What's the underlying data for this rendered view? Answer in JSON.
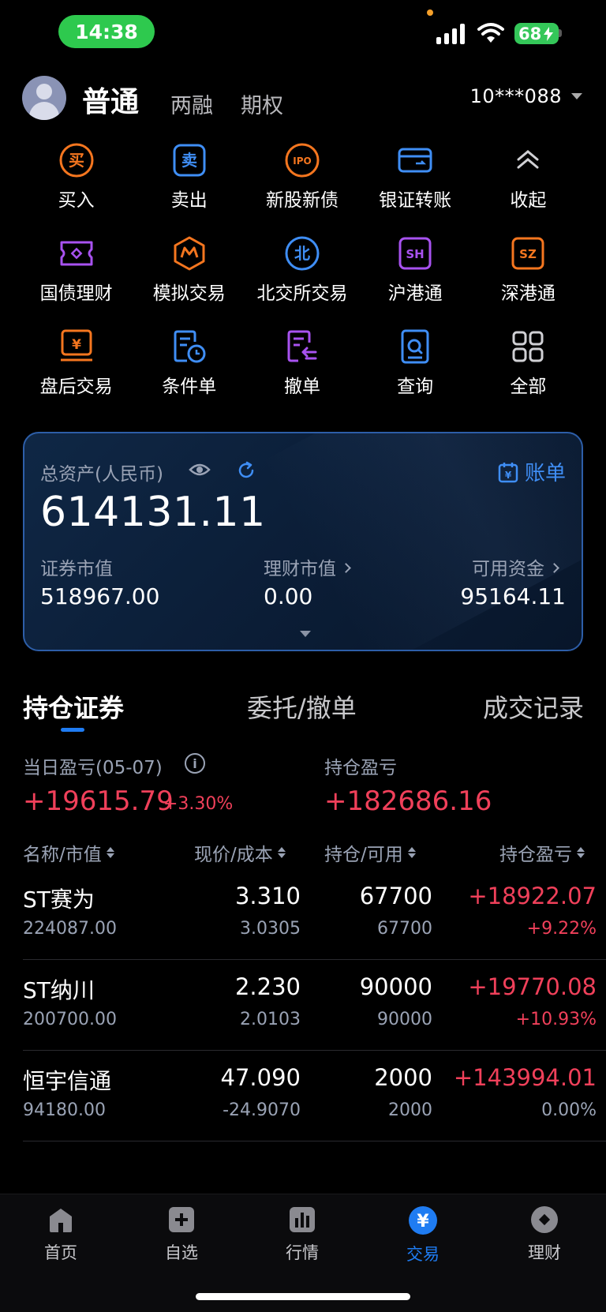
{
  "status_bar": {
    "time": "14:38",
    "battery": "68"
  },
  "account": {
    "tabs": [
      "普通",
      "两融",
      "期权"
    ],
    "account_no": "10***088"
  },
  "quick_actions": [
    {
      "label": "买入",
      "icon": "buy-icon"
    },
    {
      "label": "卖出",
      "icon": "sell-icon"
    },
    {
      "label": "新股新债",
      "icon": "ipo-icon"
    },
    {
      "label": "银证转账",
      "icon": "bank-transfer-icon"
    },
    {
      "label": "收起",
      "icon": "collapse-icon"
    },
    {
      "label": "国债理财",
      "icon": "treasury-icon"
    },
    {
      "label": "模拟交易",
      "icon": "simulate-icon"
    },
    {
      "label": "北交所交易",
      "icon": "bse-icon"
    },
    {
      "label": "沪港通",
      "icon": "sh-connect-icon"
    },
    {
      "label": "深港通",
      "icon": "sz-connect-icon"
    },
    {
      "label": "盘后交易",
      "icon": "after-hours-icon"
    },
    {
      "label": "条件单",
      "icon": "conditional-order-icon"
    },
    {
      "label": "撤单",
      "icon": "cancel-order-icon"
    },
    {
      "label": "查询",
      "icon": "query-icon"
    },
    {
      "label": "全部",
      "icon": "all-icon"
    }
  ],
  "assets": {
    "total_label": "总资产(人民币)",
    "total": "614131.11",
    "bill_label": "账单",
    "securities_label": "证券市值",
    "securities_value": "518967.00",
    "wealth_label": "理财市值",
    "wealth_value": "0.00",
    "cash_label": "可用资金",
    "cash_value": "95164.11"
  },
  "position_tabs": [
    "持仓证券",
    "委托/撤单",
    "成交记录"
  ],
  "pnl": {
    "daily_label": "当日盈亏(05-07)",
    "daily_value": "+19615.79",
    "daily_pct": "+3.30%",
    "holding_label": "持仓盈亏",
    "holding_value": "+182686.16"
  },
  "table": {
    "headers": [
      "名称/市值",
      "现价/成本",
      "持仓/可用",
      "持仓盈亏"
    ],
    "rows": [
      {
        "name": "ST赛为",
        "market_value": "224087.00",
        "price": "3.310",
        "cost": "3.0305",
        "qty": "67700",
        "avail": "67700",
        "pnl": "+18922.07",
        "pct": "+9.22%"
      },
      {
        "name": "ST纳川",
        "market_value": "200700.00",
        "price": "2.230",
        "cost": "2.0103",
        "qty": "90000",
        "avail": "90000",
        "pnl": "+19770.08",
        "pct": "+10.93%"
      },
      {
        "name": "恒宇信通",
        "market_value": "94180.00",
        "price": "47.090",
        "cost": "-24.9070",
        "qty": "2000",
        "avail": "2000",
        "pnl": "+143994.01",
        "pct": "0.00%"
      }
    ]
  },
  "bottom_nav": [
    {
      "label": "首页",
      "icon": "home-icon"
    },
    {
      "label": "自选",
      "icon": "watchlist-icon"
    },
    {
      "label": "行情",
      "icon": "market-icon"
    },
    {
      "label": "交易",
      "icon": "trade-icon",
      "active": true
    },
    {
      "label": "理财",
      "icon": "wealth-icon"
    }
  ],
  "colors": {
    "accent": "#1f7cf2",
    "rise": "#f0405a",
    "status_green": "#2ec94e"
  }
}
